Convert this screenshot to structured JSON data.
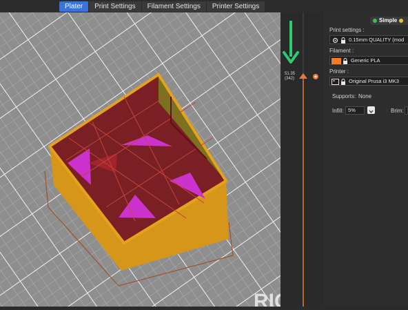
{
  "tabs": [
    {
      "label": "Plater",
      "active": true
    },
    {
      "label": "Print Settings",
      "active": false
    },
    {
      "label": "Filament Settings",
      "active": false
    },
    {
      "label": "Printer Settings",
      "active": false
    }
  ],
  "mode": {
    "label": "Simple"
  },
  "layer_slider": {
    "height": "51.35",
    "layer": "(342)"
  },
  "sidebar": {
    "print_settings_label": "Print settings :",
    "print_settings_value": "0.15mm QUALITY (mod",
    "filament_label": "Filament :",
    "filament_value": "Generic PLA",
    "filament_color": "#f07d28",
    "printer_label": "Printer :",
    "printer_value": "Original Prusa i3 MK3",
    "supports_label": "Supports:",
    "supports_value": "None",
    "infill_label": "Infill:",
    "infill_value": "5%",
    "brim_label": "Brim:"
  },
  "bed_watermark": "RIG",
  "colors": {
    "accent": "#3b74d9",
    "object_walls": "#e5a21f",
    "infill": "#cc33cc",
    "arrow": "#2ecc71"
  }
}
